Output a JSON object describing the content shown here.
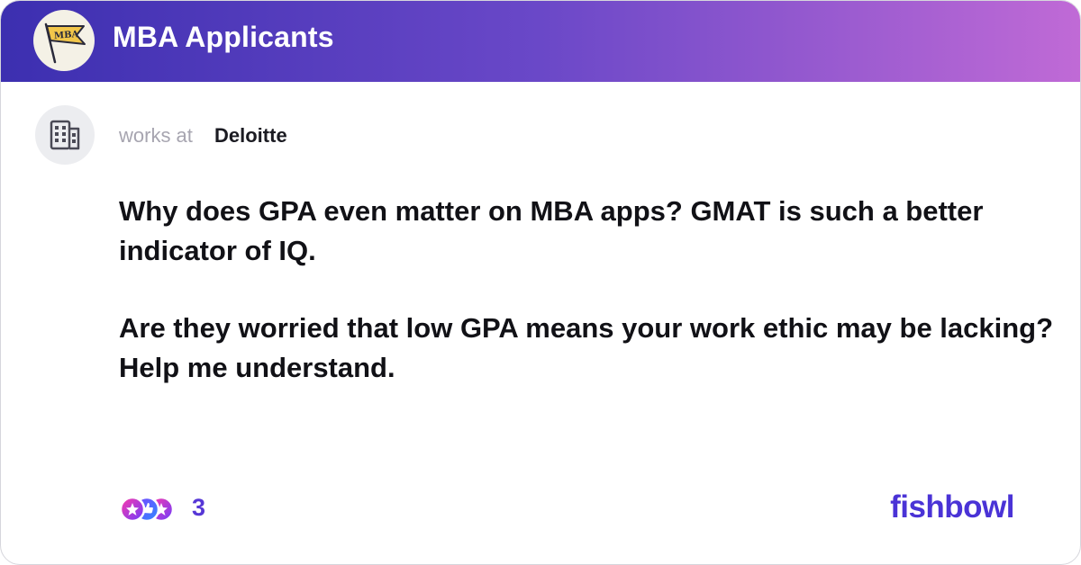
{
  "header": {
    "title": "MBA Applicants",
    "logo_text": "MBA",
    "logo_icon": "pennant-flag-icon",
    "gradient_colors": [
      "#3c2fb0",
      "#6a48c8",
      "#c06ad6"
    ]
  },
  "author": {
    "prefix": "works at",
    "company": "Deloitte",
    "avatar_icon": "building-icon"
  },
  "post": {
    "paragraphs": [
      "Why does GPA even matter on MBA apps? GMAT is such a better indicator of IQ.",
      "Are they worried that low GPA means your work ethic may be lacking? Help me understand."
    ]
  },
  "footer": {
    "reaction_icons": [
      "star-reaction-icon",
      "like-reaction-icon",
      "star-reaction-icon"
    ],
    "reaction_count": "3",
    "brand": "fishbowl",
    "brand_color": "#4a33d6"
  }
}
